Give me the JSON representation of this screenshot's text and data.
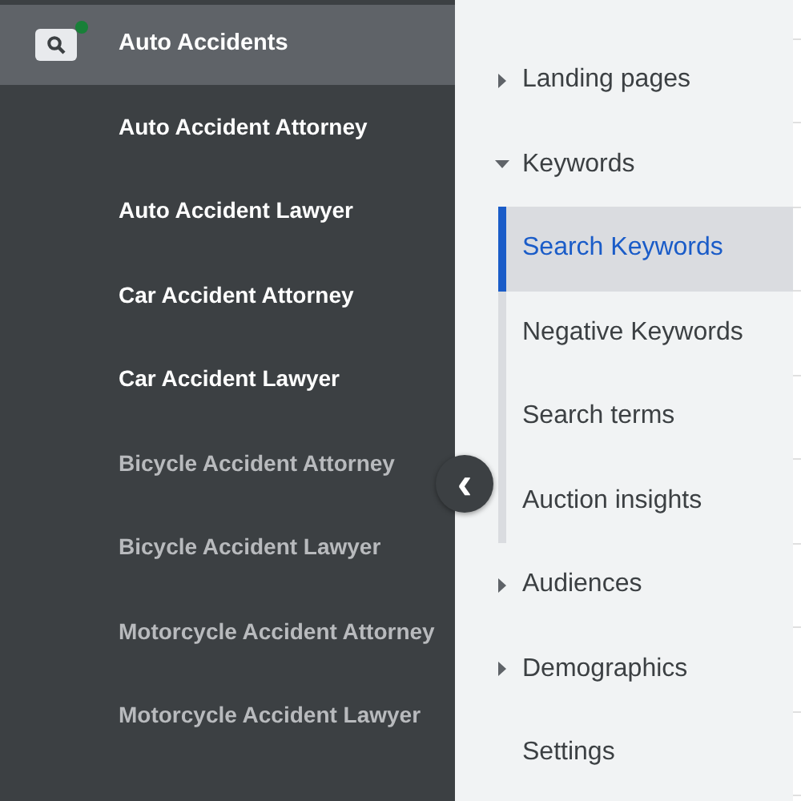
{
  "campaign": {
    "name": "Auto Accidents"
  },
  "ad_groups": [
    {
      "name": "Auto Accident Attorney",
      "dimmed": false
    },
    {
      "name": "Auto Accident Lawyer",
      "dimmed": false
    },
    {
      "name": "Car Accident Attorney",
      "dimmed": false
    },
    {
      "name": "Car Accident Lawyer",
      "dimmed": false
    },
    {
      "name": "Bicycle Accident Attorney",
      "dimmed": true
    },
    {
      "name": "Bicycle Accident Lawyer",
      "dimmed": true
    },
    {
      "name": "Motorcycle Accident Attorney",
      "dimmed": true
    },
    {
      "name": "Motorcycle Accident Lawyer",
      "dimmed": true
    }
  ],
  "collapse_button": {
    "label": "‹"
  },
  "page_menu": [
    {
      "kind": "group",
      "label": "Landing pages",
      "expanded": false
    },
    {
      "kind": "group",
      "label": "Keywords",
      "expanded": true,
      "children": [
        {
          "label": "Search Keywords",
          "selected": true
        },
        {
          "label": "Negative Keywords",
          "selected": false
        },
        {
          "label": "Search terms",
          "selected": false
        },
        {
          "label": "Auction insights",
          "selected": false
        }
      ]
    },
    {
      "kind": "group",
      "label": "Audiences",
      "expanded": false
    },
    {
      "kind": "group",
      "label": "Demographics",
      "expanded": false
    },
    {
      "kind": "item",
      "label": "Settings"
    }
  ]
}
